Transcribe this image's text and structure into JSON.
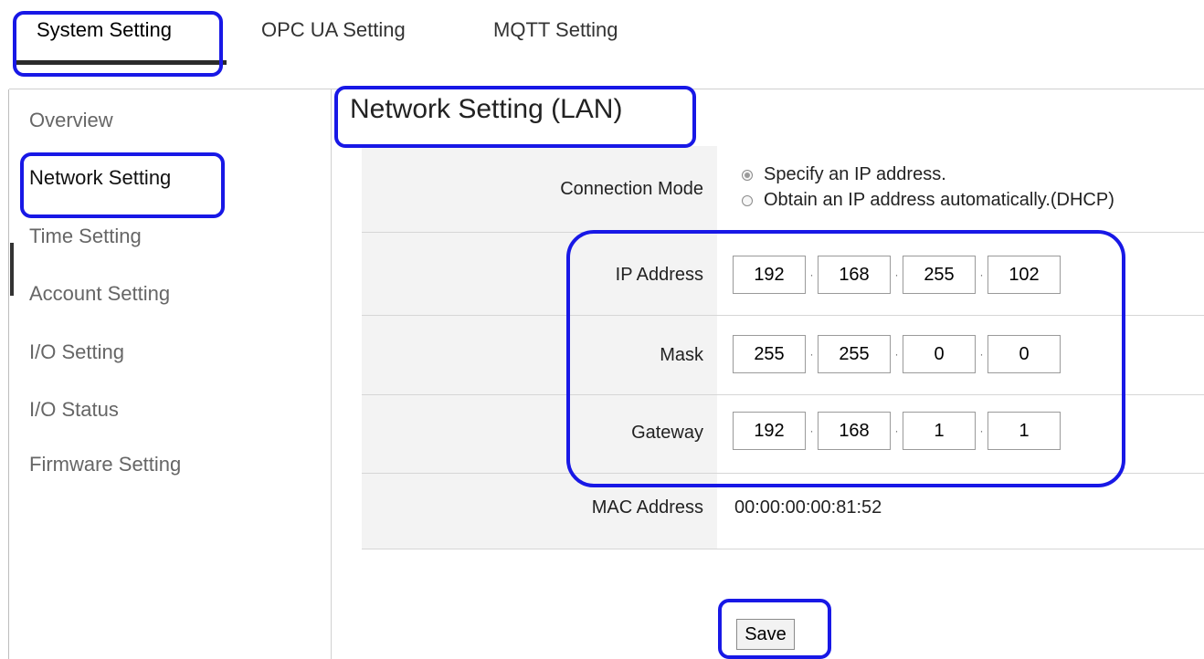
{
  "tabs": [
    {
      "label": "System Setting",
      "active": true
    },
    {
      "label": "OPC UA Setting",
      "active": false
    },
    {
      "label": "MQTT Setting",
      "active": false
    }
  ],
  "sidebar": {
    "items": [
      {
        "label": "Overview"
      },
      {
        "label": "Network Setting",
        "active": true
      },
      {
        "label": "Time Setting"
      },
      {
        "label": "Account Setting"
      },
      {
        "label": "I/O Setting"
      },
      {
        "label": "I/O Status"
      },
      {
        "label": "Firmware Setting"
      }
    ]
  },
  "main": {
    "title": "Network Setting (LAN)",
    "connection_mode": {
      "label": "Connection Mode",
      "options": [
        {
          "label": "Specify an IP address.",
          "checked": true
        },
        {
          "label": "Obtain an IP address automatically.(DHCP)",
          "checked": false
        }
      ]
    },
    "ip_address": {
      "label": "IP Address",
      "octets": [
        "192",
        "168",
        "255",
        "102"
      ]
    },
    "mask": {
      "label": "Mask",
      "octets": [
        "255",
        "255",
        "0",
        "0"
      ]
    },
    "gateway": {
      "label": "Gateway",
      "octets": [
        "192",
        "168",
        "1",
        "1"
      ]
    },
    "mac_address": {
      "label": "MAC Address",
      "value": "00:00:00:00:81:52"
    },
    "save_label": "Save"
  },
  "colors": {
    "highlight": "#1818e6",
    "form_label_bg": "#f3f3f3"
  }
}
